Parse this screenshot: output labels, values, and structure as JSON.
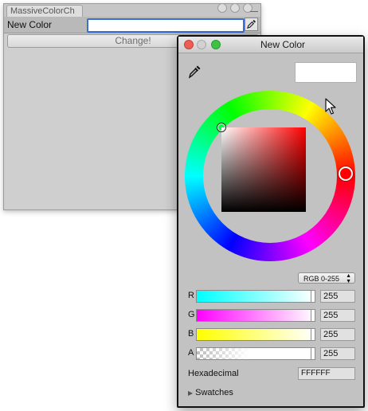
{
  "editor": {
    "tab_title": "MassiveColorCh",
    "field_label": "New Color",
    "change_button": "Change!"
  },
  "picker": {
    "title": "New Color",
    "preview_color": "#ffffff",
    "mode": "RGB 0-255",
    "channels": [
      {
        "label": "R",
        "value": "255",
        "from": "#00ffff",
        "to": "#ffffff"
      },
      {
        "label": "G",
        "value": "255",
        "from": "#ff00ff",
        "to": "#ffffff"
      },
      {
        "label": "B",
        "value": "255",
        "from": "#ffff00",
        "to": "#ffffff"
      },
      {
        "label": "A",
        "value": "255"
      }
    ],
    "hex_label": "Hexadecimal",
    "hex_value": "FFFFFF",
    "swatches_label": "Swatches"
  },
  "icons": [
    "eyedropper-icon",
    "cursor-icon",
    "disclosure-triangle-icon",
    "dropdown-arrows-icon"
  ]
}
